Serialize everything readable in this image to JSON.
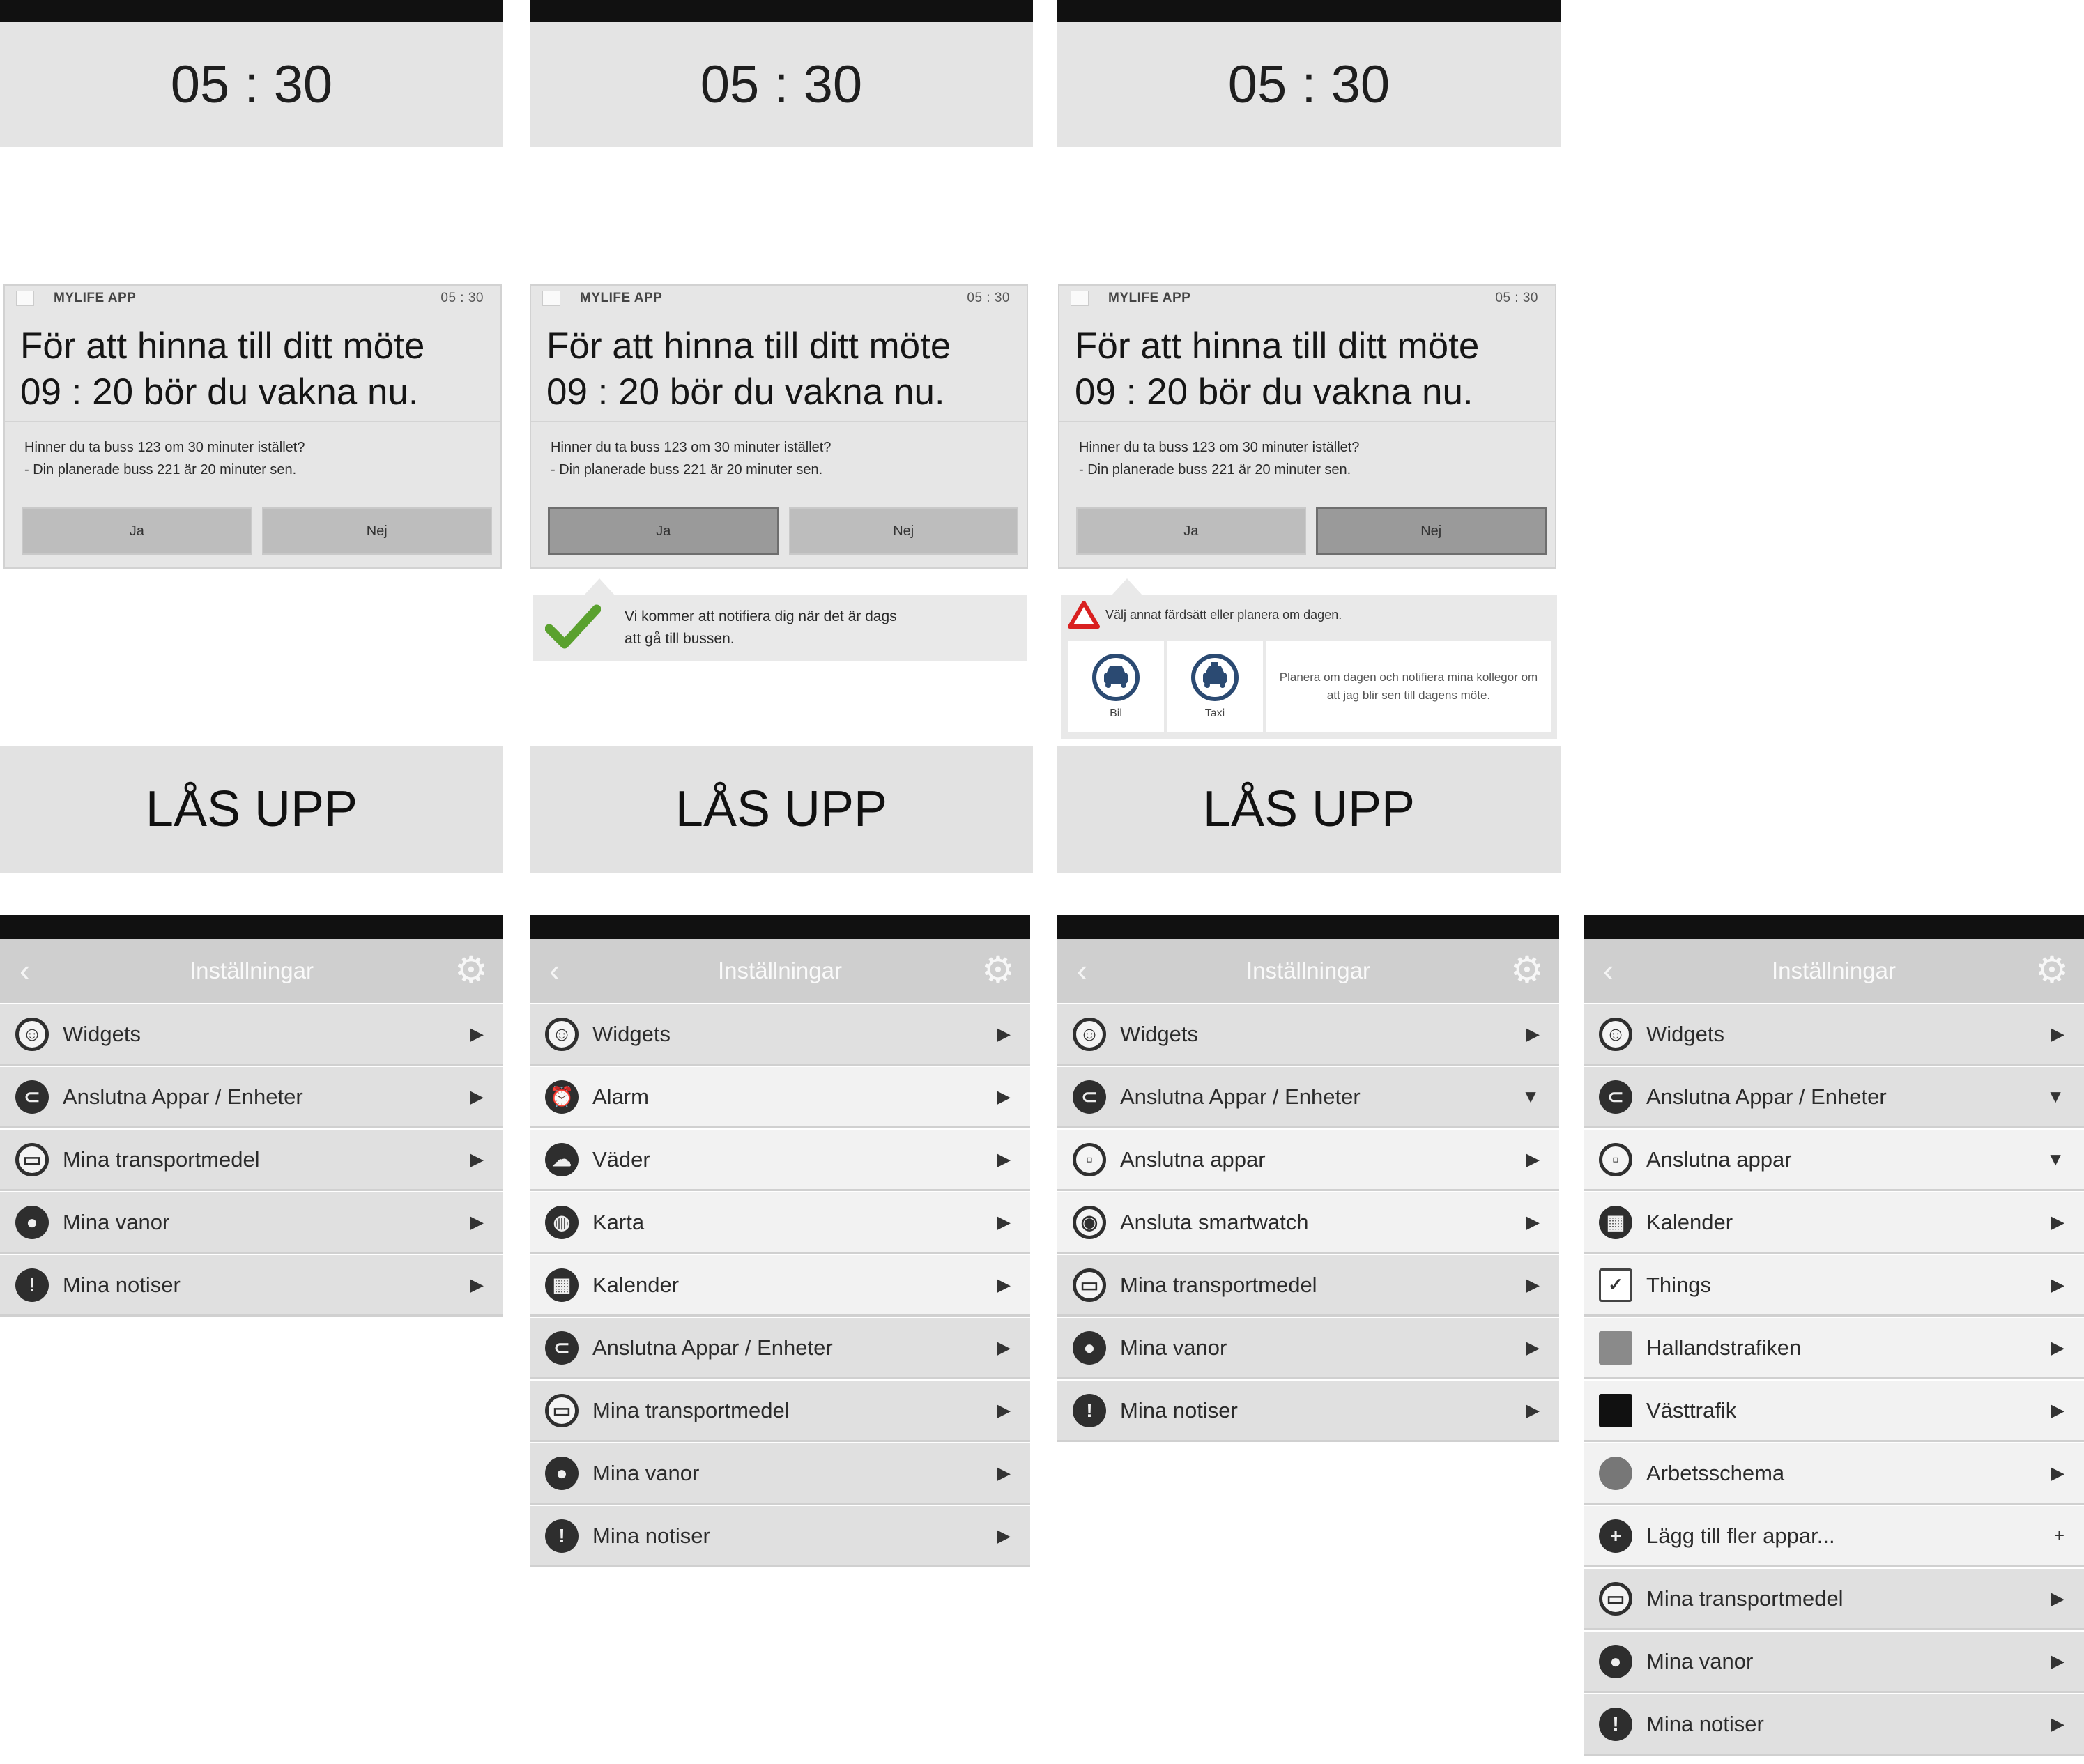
{
  "lock": {
    "clock": "05 : 30",
    "notif_app": "MYLIFE APP",
    "notif_time": "05 : 30",
    "notif_title_1": "För att hinna till ditt möte",
    "notif_title_2": "09 : 20 bör du vakna nu.",
    "notif_body_1": "Hinner du ta buss 123 om 30 minuter istället?",
    "notif_body_2": "- Din planerade buss 221 är 20 minuter sen.",
    "btn_yes": "Ja",
    "btn_no": "Nej",
    "unlock": "LÅS UPP",
    "confirm_1": "Vi kommer att notifiera dig när det är dags",
    "confirm_2": "att gå till bussen.",
    "warn_text": "Välj annat färdsätt eller planera om dagen.",
    "opt_car": "Bil",
    "opt_taxi": "Taxi",
    "opt_replan": "Planera om dagen och notifiera mina kollegor om att jag blir sen till dagens möte."
  },
  "settings": {
    "title": "Inställningar",
    "widgets": "Widgets",
    "connected": "Anslutna Appar / Enheter",
    "transport": "Mina transportmedel",
    "habits": "Mina vanor",
    "notices": "Mina notiser",
    "alarm": "Alarm",
    "weather": "Väder",
    "map": "Karta",
    "calendar": "Kalender",
    "connected_apps": "Anslutna appar",
    "smartwatch": "Ansluta smartwatch",
    "things": "Things",
    "hallandstrafiken": "Hallandstrafiken",
    "vasttrafik": "Västtrafik",
    "workschedule": "Arbetsschema",
    "add_more": "Lägg till fler appar..."
  },
  "colors": {
    "check": "#5aa12e",
    "warning": "#d92020",
    "icon_blue": "#2b4a72"
  }
}
